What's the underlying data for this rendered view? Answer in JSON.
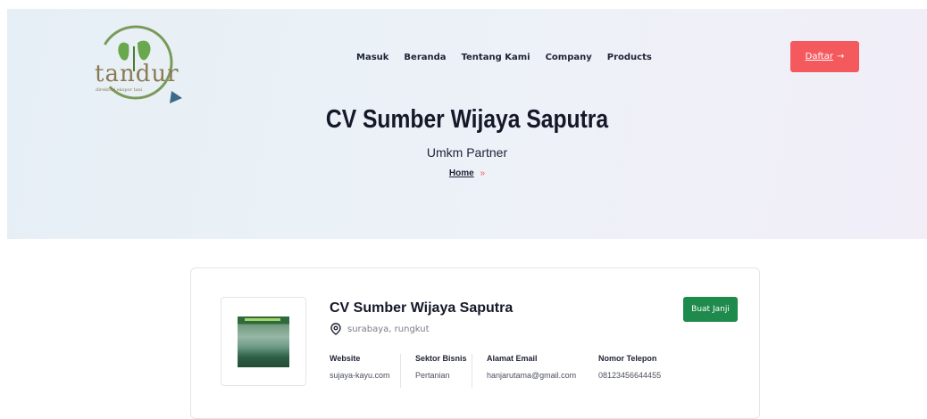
{
  "logo": {
    "name": "tandur",
    "tagline": "direktori ekspor tani"
  },
  "nav": {
    "items": [
      "Masuk",
      "Beranda",
      "Tentang Kami",
      "Company",
      "Products"
    ]
  },
  "header": {
    "register_label": "Daftar",
    "register_arrow": "→"
  },
  "hero": {
    "title": "CV Sumber Wijaya Saputra",
    "subtitle": "Umkm Partner",
    "breadcrumb_home": "Home",
    "breadcrumb_sep": "»"
  },
  "company": {
    "name": "CV Sumber Wijaya Saputra",
    "location": "surabaya, rungkut",
    "appointment_label": "Buat Janji",
    "info": [
      {
        "label": "Website",
        "value": "sujaya-kayu.com"
      },
      {
        "label": "Sektor Bisnis",
        "value": "Pertanian"
      },
      {
        "label": "Alamat Email",
        "value": "hanjarutama@gmail.com"
      },
      {
        "label": "Nomor Telepon",
        "value": "08123456644455"
      }
    ]
  },
  "colors": {
    "accent": "#f4595e",
    "primary_green": "#1e8a4c",
    "text_dark": "#16182a"
  }
}
